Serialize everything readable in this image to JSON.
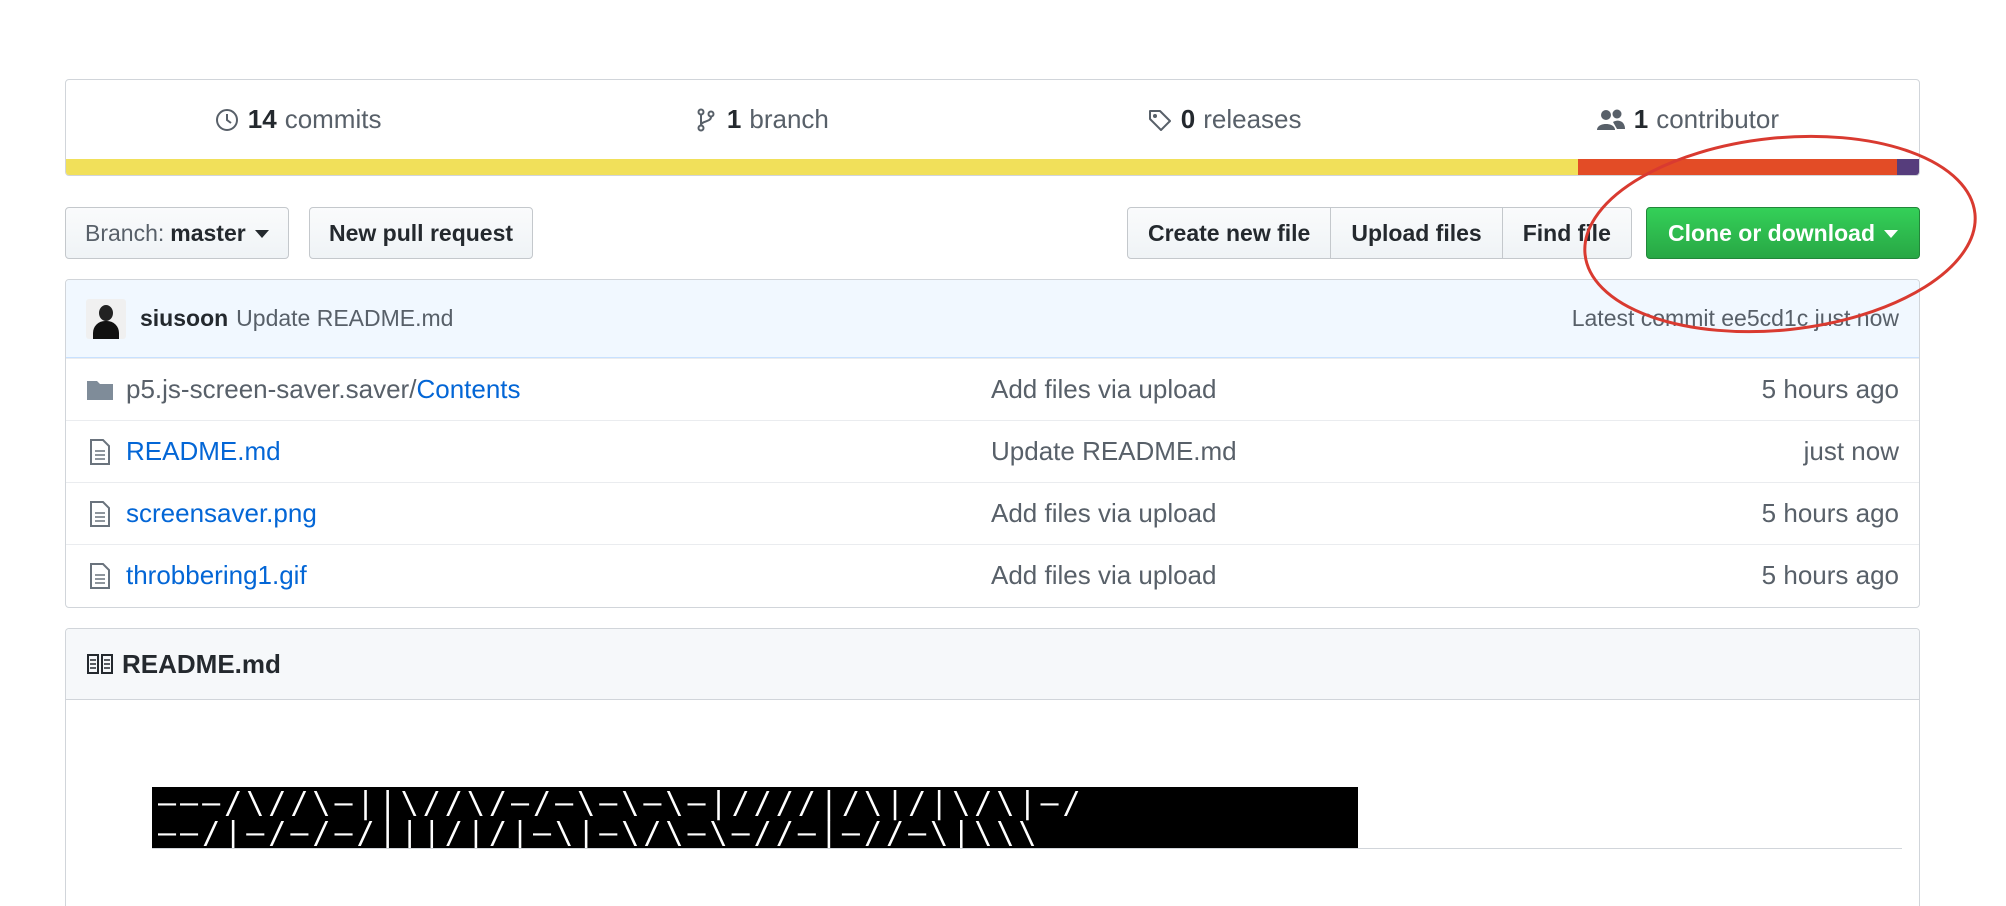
{
  "summary": {
    "commits": {
      "count": "14",
      "label": "commits"
    },
    "branches": {
      "count": "1",
      "label": "branch"
    },
    "releases": {
      "count": "0",
      "label": "releases"
    },
    "contributors": {
      "count": "1",
      "label": "contributor"
    }
  },
  "language_bar": [
    {
      "share": 81.6,
      "color": "#f1e05a"
    },
    {
      "share": 17.2,
      "color": "#e34c26"
    },
    {
      "share": 1.2,
      "color": "#563d7c"
    }
  ],
  "toolbar": {
    "branch_prefix": "Branch:",
    "branch_name": "master",
    "new_pull_request": "New pull request",
    "create_new_file": "Create new file",
    "upload_files": "Upload files",
    "find_file": "Find file",
    "clone_or_download": "Clone or download"
  },
  "commit_tease": {
    "author": "siusoon",
    "message": "Update README.md",
    "latest": "Latest commit ee5cd1c just now"
  },
  "files": [
    {
      "icon": "folder-icon",
      "path": "p5.js-screen-saver.saver/",
      "name": "Contents",
      "message": "Add files via upload",
      "age": "5 hours ago"
    },
    {
      "icon": "file-icon",
      "path": "",
      "name": "README.md",
      "message": "Update README.md",
      "age": "just now"
    },
    {
      "icon": "file-icon",
      "path": "",
      "name": "screensaver.png",
      "message": "Add files via upload",
      "age": "5 hours ago"
    },
    {
      "icon": "file-icon",
      "path": "",
      "name": "throbbering1.gif",
      "message": "Add files via upload",
      "age": "5 hours ago"
    }
  ],
  "readme": {
    "title": "README.md",
    "image_line1": "———/\\//\\—||\\//\\/—/—\\—\\—\\—|////|/\\|/|\\/\\|—/",
    "image_line2": "——/|—/—/—/|||/|/|—\\|—\\/\\—\\—//—|—//—\\|\\\\\\"
  },
  "colors": {
    "accent_link": "#0366d6",
    "green_button": "#28a745",
    "annotation_circle": "#d93a30"
  }
}
